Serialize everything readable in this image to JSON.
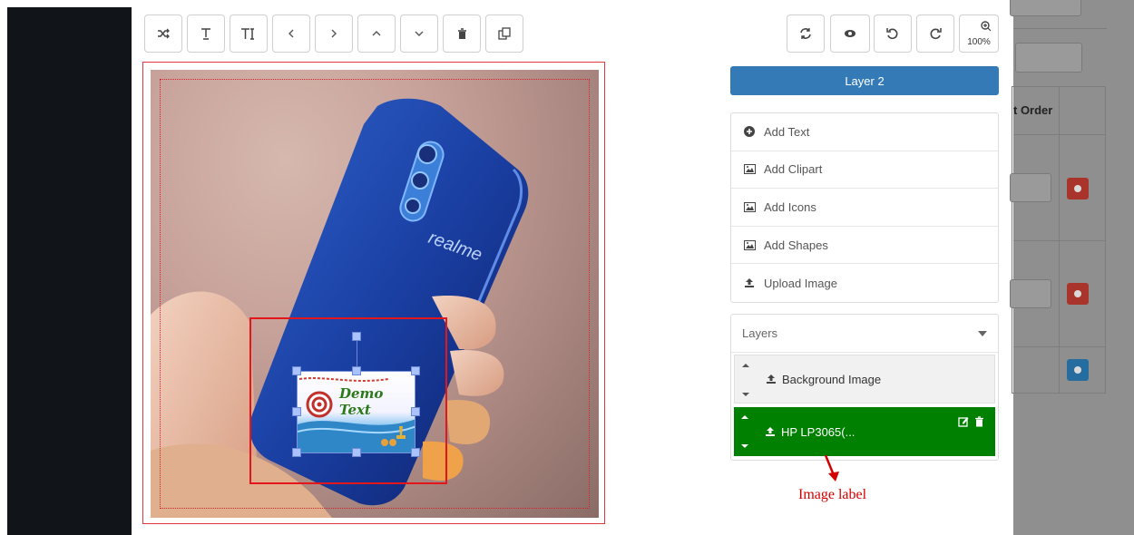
{
  "toolbar_left": [
    {
      "name": "shuffle-icon",
      "label": ""
    },
    {
      "name": "text-icon",
      "label": ""
    },
    {
      "name": "text-size-icon",
      "label": ""
    },
    {
      "name": "chevron-left-icon",
      "label": ""
    },
    {
      "name": "chevron-right-icon",
      "label": ""
    },
    {
      "name": "chevron-up-icon",
      "label": ""
    },
    {
      "name": "chevron-down-icon",
      "label": ""
    },
    {
      "name": "trash-icon",
      "label": ""
    },
    {
      "name": "clone-icon",
      "label": ""
    }
  ],
  "toolbar_right": {
    "refresh_icon": "refresh-icon",
    "preview_icon": "eye-icon",
    "undo_icon": "undo-icon",
    "redo_icon": "redo-icon",
    "zoom_label": "100%"
  },
  "canvas": {
    "clipart_text": "Demo Text",
    "photo_brand": "realme"
  },
  "panel": {
    "layer_button": "Layer 2",
    "menu": [
      {
        "label": "Add Text",
        "icon": "plus-circle-icon"
      },
      {
        "label": "Add Clipart",
        "icon": "image-icon"
      },
      {
        "label": "Add Icons",
        "icon": "image-icon"
      },
      {
        "label": "Add Shapes",
        "icon": "image-icon"
      },
      {
        "label": "Upload Image",
        "icon": "upload-icon"
      }
    ],
    "layers_title": "Layers",
    "layers": [
      {
        "label": "Background Image"
      },
      {
        "label": "HP LP3065(..."
      }
    ]
  },
  "annotation": {
    "text": "Image label"
  },
  "right_background": {
    "header": "t Order"
  },
  "colors": {
    "primary": "#337ab7",
    "active_layer": "#008000",
    "selection": "#e3171b",
    "annotation": "#d40000"
  }
}
